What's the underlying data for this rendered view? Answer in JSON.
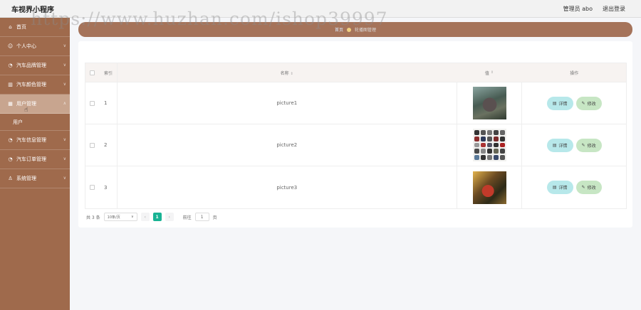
{
  "header": {
    "title": "车视界小程序",
    "user_label": "管理员 abo",
    "logout_label": "退出登录"
  },
  "sidebar": {
    "items": [
      {
        "label": "首页",
        "icon": "home-icon"
      },
      {
        "label": "个人中心",
        "icon": "user-icon"
      },
      {
        "label": "汽车品牌管理",
        "icon": "car-icon"
      },
      {
        "label": "汽车颜色管理",
        "icon": "chart-icon"
      },
      {
        "label": "用户管理",
        "icon": "grid-icon"
      },
      {
        "label": "汽车信息管理",
        "icon": "car-icon"
      },
      {
        "label": "汽车订单管理",
        "icon": "car-icon"
      },
      {
        "label": "系统管理",
        "icon": "people-icon"
      }
    ],
    "sub_item": "用户",
    "active_index": 4
  },
  "breadcrumb": {
    "home": "首页",
    "current": "轮播图管理"
  },
  "table": {
    "headers": {
      "index": "索引",
      "name": "名称",
      "value": "值",
      "actions": "操作"
    },
    "rows": [
      {
        "index": "1",
        "name": "picture1"
      },
      {
        "index": "2",
        "name": "picture2"
      },
      {
        "index": "3",
        "name": "picture3"
      }
    ],
    "detail_label": "详情",
    "edit_label": "修改"
  },
  "pagination": {
    "total": "共 3 条",
    "page_size": "10条/页",
    "current_page": "1",
    "goto_label": "前往",
    "goto_value": "1",
    "page_unit": "页"
  },
  "watermark": "https://www.huzhan.com/ishop39997",
  "colors": {
    "sidebar": "#9f6a4c",
    "breadcrumb": "#a5735a",
    "accent": "#19b394",
    "detail_button": "#b7e8ea",
    "edit_button": "#c7e6c4"
  }
}
